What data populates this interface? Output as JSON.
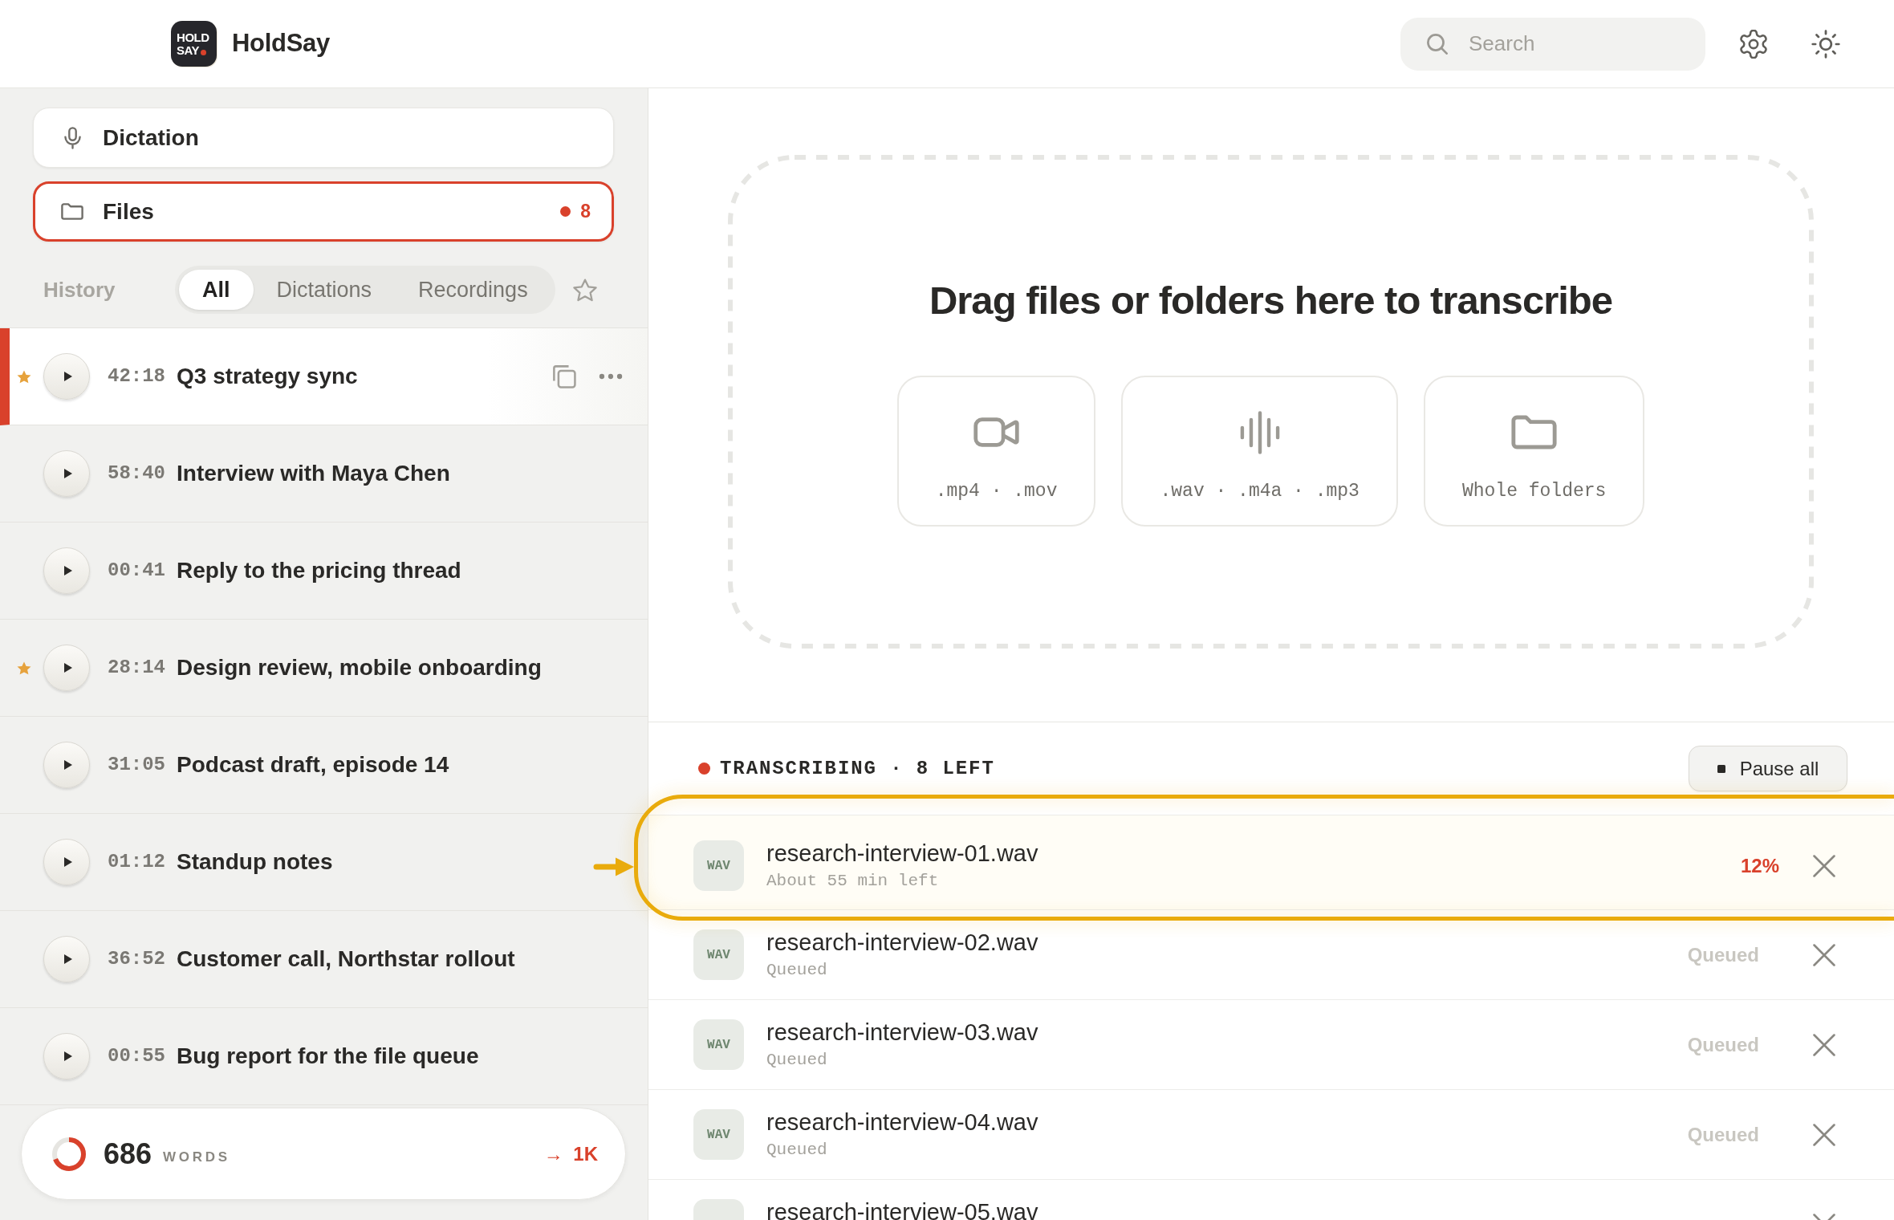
{
  "app": {
    "logo_lines": [
      "HOLD",
      "SAY"
    ],
    "name": "HoldSay"
  },
  "search": {
    "placeholder": "Search"
  },
  "nav": [
    {
      "kind": "mic",
      "label": "Dictation",
      "selected": false
    },
    {
      "kind": "folder",
      "label": "Files",
      "selected": true,
      "badge": "8"
    }
  ],
  "history": {
    "label": "History",
    "tabs": [
      {
        "label": "All",
        "selected": true
      },
      {
        "label": "Dictations",
        "selected": false
      },
      {
        "label": "Recordings",
        "selected": false
      }
    ]
  },
  "recordings": [
    {
      "duration": "42:18",
      "title": "Q3 strategy sync",
      "starred": true,
      "selected": true
    },
    {
      "duration": "58:40",
      "title": "Interview with Maya Chen",
      "starred": false,
      "selected": false
    },
    {
      "duration": "00:41",
      "title": "Reply to the pricing thread",
      "starred": false,
      "selected": false
    },
    {
      "duration": "28:14",
      "title": "Design review, mobile onboarding",
      "starred": true,
      "selected": false
    },
    {
      "duration": "31:05",
      "title": "Podcast draft, episode 14",
      "starred": false,
      "selected": false
    },
    {
      "duration": "01:12",
      "title": "Standup notes",
      "starred": false,
      "selected": false
    },
    {
      "duration": "36:52",
      "title": "Customer call, Northstar rollout",
      "starred": false,
      "selected": false
    },
    {
      "duration": "00:55",
      "title": "Bug report for the file queue",
      "starred": false,
      "selected": false
    }
  ],
  "word_count": {
    "count": "686",
    "unit": "WORDS",
    "goal": "→ 1K",
    "level": 0.69
  },
  "drop_zone": {
    "title": "Drag files or folders here to transcribe",
    "formats": [
      {
        "kind": "video",
        "label": ".mp4 · .mov"
      },
      {
        "kind": "audio",
        "label": ".wav · .m4a · .mp3"
      },
      {
        "kind": "folder",
        "label": "Whole folders"
      }
    ]
  },
  "queue": {
    "status": "TRANSCRIBING · 8 LEFT",
    "pause_button": "Pause all",
    "items": [
      {
        "type": "WAV",
        "name": "research-interview-01.wav",
        "detail": "About 55 min left",
        "status": "12%",
        "active": true,
        "highlighted": true
      },
      {
        "type": "WAV",
        "name": "research-interview-02.wav",
        "detail": "Queued",
        "status": "Queued",
        "active": false,
        "highlighted": false
      },
      {
        "type": "WAV",
        "name": "research-interview-03.wav",
        "detail": "Queued",
        "status": "Queued",
        "active": false,
        "highlighted": false
      },
      {
        "type": "WAV",
        "name": "research-interview-04.wav",
        "detail": "Queued",
        "status": "Queued",
        "active": false,
        "highlighted": false
      },
      {
        "name": "research-interview-05.wav",
        "active": false,
        "highlighted": false
      }
    ]
  }
}
